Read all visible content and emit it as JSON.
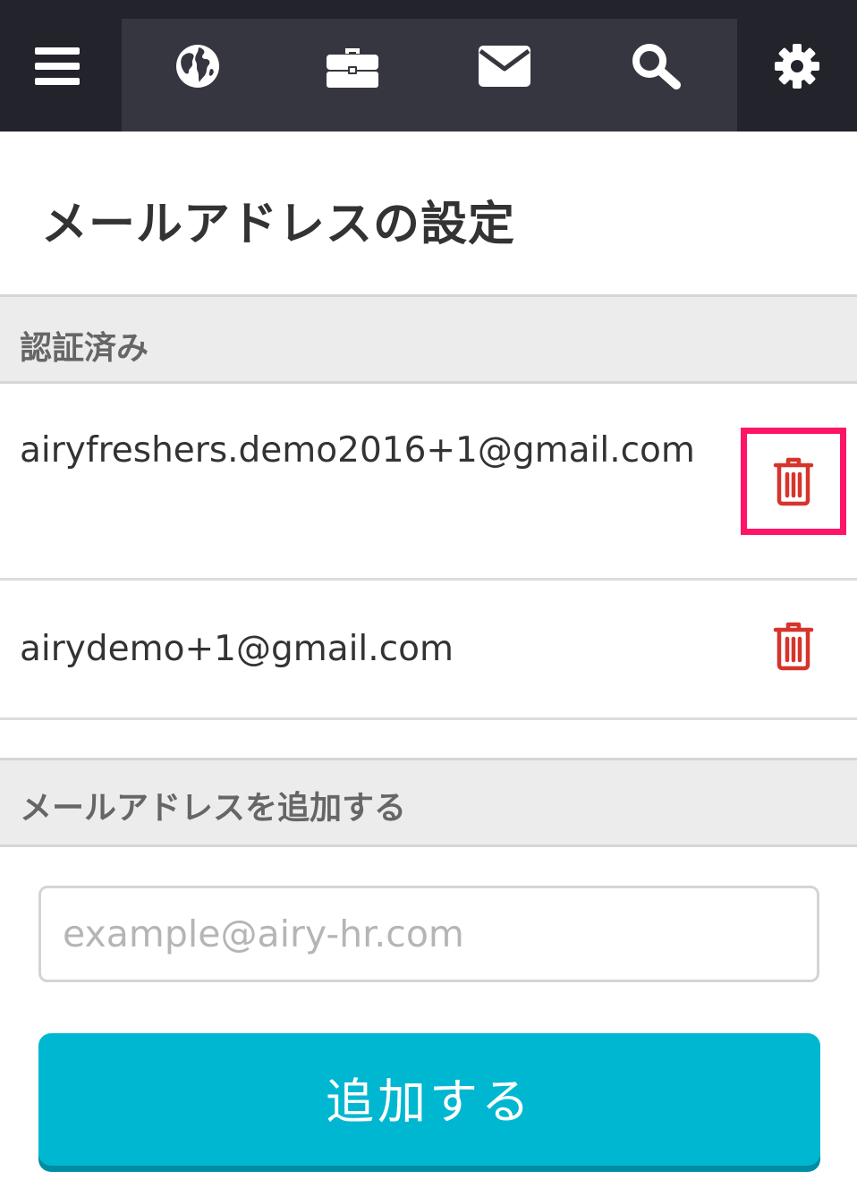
{
  "nav": {
    "icons": [
      "menu-icon",
      "globe-icon",
      "briefcase-icon",
      "envelope-icon",
      "search-icon",
      "gear-icon"
    ]
  },
  "page": {
    "title": "メールアドレスの設定"
  },
  "verified": {
    "header": "認証済み",
    "emails": [
      "airyfreshers.demo2016+1@gmail.com",
      "airydemo+1@gmail.com"
    ],
    "delete_icon": "trash-icon",
    "delete_color": "#d6342c",
    "highlight_color": "#ff1567"
  },
  "add": {
    "header": "メールアドレスを追加する",
    "input_placeholder": "example@airy-hr.com",
    "button_label": "追加する",
    "button_color": "#00b7d1"
  }
}
